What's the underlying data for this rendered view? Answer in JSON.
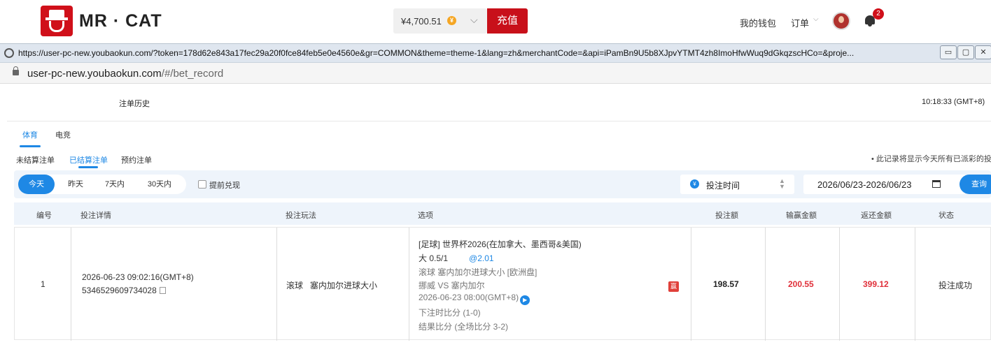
{
  "app": {
    "brand": "MR · CAT",
    "balance": "¥4,700.51",
    "coin_symbol": "¥",
    "recharge_label": "充值",
    "wallet_label": "我的钱包",
    "orders_label": "订单",
    "notification_count": "2",
    "accent": "#1e88e5",
    "brand_red": "#c8101a"
  },
  "browser": {
    "popup_url": "https://user-pc-new.youbaokun.com/?token=178d62e843a17fec29a20f0fce84feb5e0e4560e&gr=COMMON&theme=theme-1&lang=zh&merchantCode=&api=iPamBn9U5b8XJpvYTMT4zh8ImoHfwWuq9dGkqzscHCo=&proje...",
    "address_domain": "user-pc-new.youbaokun.com",
    "address_path": "/#/bet_record",
    "minimize": "▭",
    "maximize": "▢",
    "close": "✕"
  },
  "page": {
    "title": "注单历史",
    "clock": "10:18:33 (GMT+8)",
    "tabs": [
      {
        "label": "体育"
      },
      {
        "label": "电竞"
      }
    ],
    "subtabs": [
      {
        "label": "未结算注单"
      },
      {
        "label": "已结算注单"
      },
      {
        "label": "预约注单"
      }
    ],
    "note": "• 此记录将显示今天所有已派彩的投"
  },
  "filters": {
    "days": [
      {
        "label": "今天"
      },
      {
        "label": "昨天"
      },
      {
        "label": "7天内"
      },
      {
        "label": "30天内"
      }
    ],
    "early_cashout": "提前兑现",
    "sort_label": "投注时间",
    "date_range": "2026/06/23-2026/06/23",
    "query": "查询"
  },
  "table": {
    "headers": [
      "编号",
      "投注详情",
      "投注玩法",
      "选项",
      "投注额",
      "输赢金额",
      "返还金额",
      "状态"
    ],
    "rows": [
      {
        "no": "1",
        "time": "2026-06-23 09:02:16(GMT+8)",
        "order_id": "5346529609734028",
        "play": "滚球   塞内加尔进球大小",
        "option": {
          "league": "[足球] 世界杯2026(在加拿大、墨西哥&美国)",
          "pick": "大 0.5/1",
          "odds": "@2.01",
          "market": "滚球 塞内加尔进球大小 [欧洲盘]",
          "match": "挪威 VS 塞内加尔",
          "kickoff": "2026-06-23 08:00(GMT+8)",
          "bet_score": "下注时比分 (1-0)",
          "final_score": "结果比分 (全场比分 3-2)",
          "win_badge": "赢"
        },
        "stake": "198.57",
        "win_loss": "200.55",
        "return": "399.12",
        "status": "投注成功"
      }
    ]
  }
}
